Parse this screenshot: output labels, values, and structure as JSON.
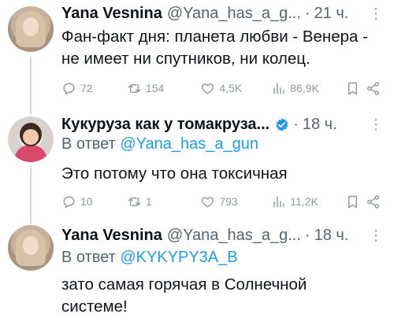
{
  "tweets": [
    {
      "name": "Yana Vesnina",
      "handle": "@Yana_has_a_g...",
      "time": "21 ч.",
      "text": "Фан-факт дня: планета любви - Венера - не имеет ни спутников, ни колец.",
      "stats": {
        "replies": "72",
        "retweets": "154",
        "likes": "4,5K",
        "views": "86,9K"
      }
    },
    {
      "name": "Кукуруза как у томакруза...",
      "verified": true,
      "time": "18 ч.",
      "reply_prefix": "В ответ",
      "reply_mention": "@Yana_has_a_gun",
      "text": "Это потому что она токсичная",
      "stats": {
        "replies": "10",
        "retweets": "1",
        "likes": "793",
        "views": "11,2K"
      }
    },
    {
      "name": "Yana Vesnina",
      "handle": "@Yana_has_a_g...",
      "time": "18 ч.",
      "reply_prefix": "В ответ",
      "reply_mention": "@KYKYPY3A_B",
      "text": "зато самая горячая в Солнечной системе!"
    }
  ],
  "separator": "·",
  "more_label": "⋮",
  "colors": {
    "accent": "#1d9bf0",
    "muted": "#536471",
    "icon": "#8b98a5"
  },
  "icons": [
    "reply-icon",
    "retweet-icon",
    "like-icon",
    "views-icon",
    "bookmark-icon",
    "share-icon",
    "verified-badge-icon",
    "more-icon"
  ]
}
